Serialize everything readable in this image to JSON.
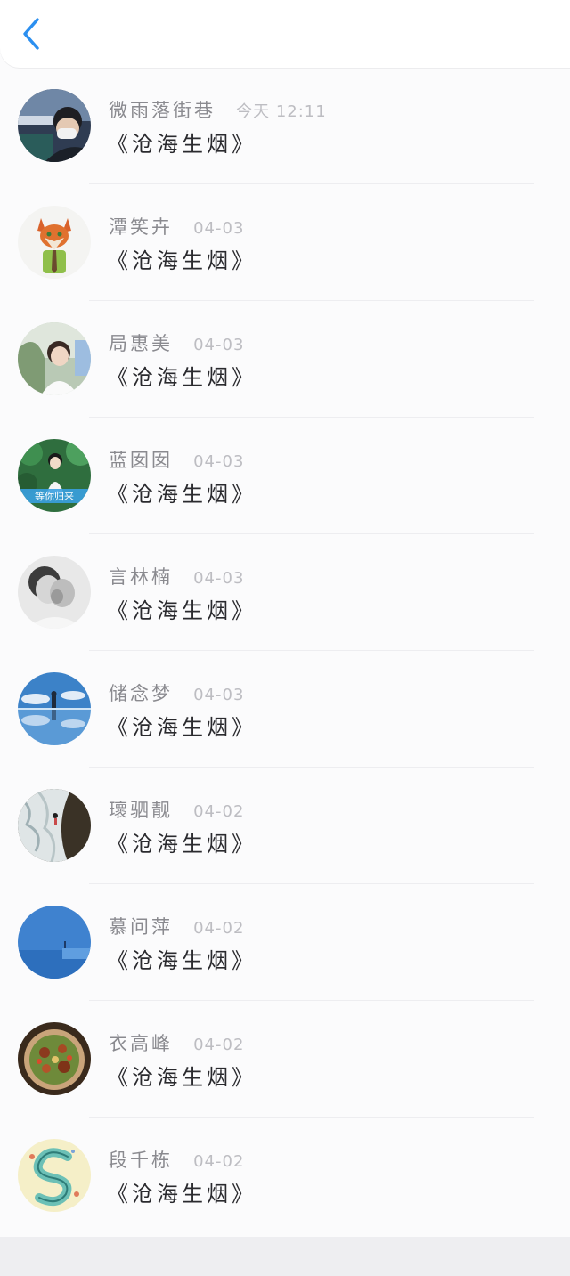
{
  "header": {
    "back_icon": "chevron-left-icon",
    "accent": "#2b8ff0"
  },
  "messages": [
    {
      "name": "微雨落街巷",
      "time": "今天 12:11",
      "text": "《沧海生烟》",
      "avatar": "photo-man-mask"
    },
    {
      "name": "潭笑卉",
      "time": "04-03",
      "text": "《沧海生烟》",
      "avatar": "cartoon-fox"
    },
    {
      "name": "局惠美",
      "time": "04-03",
      "text": "《沧海生烟》",
      "avatar": "photo-girl-white"
    },
    {
      "name": "蓝囡囡",
      "time": "04-03",
      "text": "《沧海生烟》",
      "avatar": "photo-girl-forest",
      "avatar_caption": "等你归来"
    },
    {
      "name": "言林楠",
      "time": "04-03",
      "text": "《沧海生烟》",
      "avatar": "photo-bw-couple"
    },
    {
      "name": "储念梦",
      "time": "04-03",
      "text": "《沧海生烟》",
      "avatar": "photo-sky-reflection"
    },
    {
      "name": "瓌驷靓",
      "time": "04-02",
      "text": "《沧海生烟》",
      "avatar": "photo-waves"
    },
    {
      "name": "慕问萍",
      "time": "04-02",
      "text": "《沧海生烟》",
      "avatar": "photo-blue-sea"
    },
    {
      "name": "衣高峰",
      "time": "04-02",
      "text": "《沧海生烟》",
      "avatar": "photo-food-plate"
    },
    {
      "name": "段千栋",
      "time": "04-02",
      "text": "《沧海生烟》",
      "avatar": "illustration-letter-s"
    }
  ]
}
